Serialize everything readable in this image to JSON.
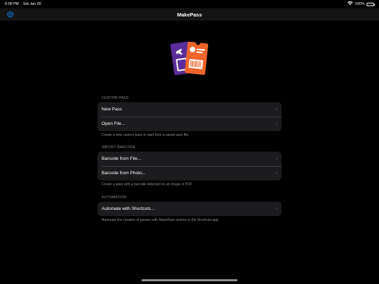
{
  "status": {
    "time": "6:08 PM",
    "date": "Sat Jan 30",
    "battery": "100%"
  },
  "nav": {
    "title": "MakePass"
  },
  "sections": [
    {
      "header": "CUSTOM PASS",
      "rows": [
        "New Pass",
        "Open File..."
      ],
      "footer": "Create a new custom pass or start from a saved pass file."
    },
    {
      "header": "IMPORT BARCODE",
      "rows": [
        "Barcode from File...",
        "Barcode from Photo..."
      ],
      "footer": "Create a pass with a barcode detected on an image or PDF."
    },
    {
      "header": "AUTOMATION",
      "rows": [
        "Automate with Shortcuts..."
      ],
      "footer": "Automate the creation of passes with MakePass actions in the Shortcuts app."
    }
  ],
  "colors": {
    "accent": "#0a84ff",
    "pass_purple": "#5b2d9a",
    "pass_orange": "#f0652a"
  }
}
